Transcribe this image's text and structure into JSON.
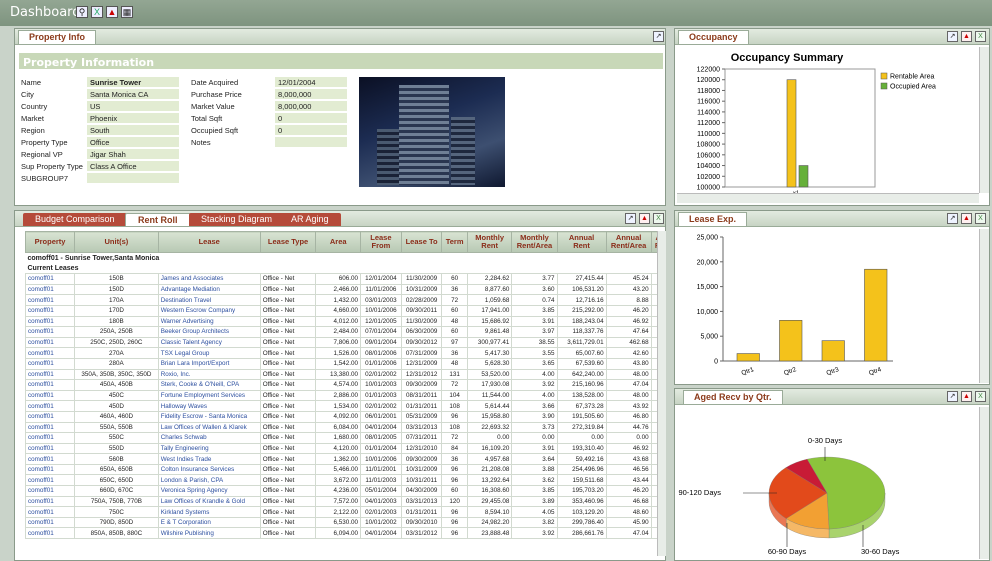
{
  "app": {
    "title": "Dashboard"
  },
  "property_info": {
    "tab": "Property Info",
    "section_title": "Property Information",
    "fields": [
      {
        "label": "Name",
        "value": "Sunrise Tower"
      },
      {
        "label": "City",
        "value": "Santa Monica CA"
      },
      {
        "label": "Country",
        "value": "US"
      },
      {
        "label": "Market",
        "value": "Phoenix"
      },
      {
        "label": "Region",
        "value": "South"
      },
      {
        "label": "Property Type",
        "value": "Office"
      },
      {
        "label": "Regional VP",
        "value": "Jigar Shah"
      },
      {
        "label": "Sup Property Type",
        "value": "Class A Office"
      },
      {
        "label": "SUBGROUP7",
        "value": ""
      }
    ],
    "fields2": [
      {
        "label": "Date Acquired",
        "value": "12/01/2004"
      },
      {
        "label": "Purchase Price",
        "value": "8,000,000"
      },
      {
        "label": "Market Value",
        "value": "8,000,000"
      },
      {
        "label": "Total Sqft",
        "value": "0"
      },
      {
        "label": "Occupied Sqft",
        "value": "0"
      },
      {
        "label": "Notes",
        "value": ""
      }
    ]
  },
  "occupancy": {
    "tab": "Occupancy",
    "chart_data": {
      "type": "bar",
      "title": "Occupancy Summary",
      "categories": [
        "x1"
      ],
      "series": [
        {
          "name": "Rentable Area",
          "values": [
            120000
          ],
          "color": "#f4c21b"
        },
        {
          "name": "Occupied Area",
          "values": [
            104000
          ],
          "color": "#66b03a"
        }
      ],
      "ylim": [
        100000,
        122000
      ],
      "yticks": [
        "122000",
        "120000",
        "118000",
        "116000",
        "114000",
        "112000",
        "110000",
        "108000",
        "106000",
        "104000",
        "102000",
        "100000"
      ],
      "legend": "top-right"
    }
  },
  "rent_roll": {
    "tabs": [
      "Budget Comparison",
      "Rent Roll",
      "Stacking Diagram",
      "AR Aging"
    ],
    "columns": [
      "Property",
      "Unit(s)",
      "Lease",
      "Lease Type",
      "Area",
      "Lease From",
      "Lease To",
      "Term",
      "Monthly Rent",
      "Monthly Rent/Area",
      "Annual Rent",
      "Annual Rent/Area",
      "Ann Rec."
    ],
    "group_title": "comoff01 - Sunrise Tower,Santa Monica",
    "subgroup_title": "Current Leases",
    "rows": [
      [
        "comoff01",
        "150B",
        "James and Associates",
        "Office - Net",
        "606.00",
        "12/01/2004",
        "11/30/2009",
        "60",
        "2,284.62",
        "3.77",
        "27,415.44",
        "45.24"
      ],
      [
        "comoff01",
        "150D",
        "Advantage Mediation",
        "Office - Net",
        "2,466.00",
        "11/01/2006",
        "10/31/2009",
        "36",
        "8,877.60",
        "3.60",
        "106,531.20",
        "43.20"
      ],
      [
        "comoff01",
        "170A",
        "Destination Travel",
        "Office - Net",
        "1,432.00",
        "03/01/2003",
        "02/28/2009",
        "72",
        "1,059.68",
        "0.74",
        "12,716.16",
        "8.88"
      ],
      [
        "comoff01",
        "170D",
        "Western Escrow Company",
        "Office - Net",
        "4,660.00",
        "10/01/2006",
        "09/30/2011",
        "60",
        "17,941.00",
        "3.85",
        "215,292.00",
        "46.20"
      ],
      [
        "comoff01",
        "180B",
        "Warner Advertising",
        "Office - Net",
        "4,012.00",
        "12/01/2005",
        "11/30/2009",
        "48",
        "15,686.92",
        "3.91",
        "188,243.04",
        "46.92"
      ],
      [
        "comoff01",
        "250A, 250B",
        "Beeker Group Architects",
        "Office - Net",
        "2,484.00",
        "07/01/2004",
        "06/30/2009",
        "60",
        "9,861.48",
        "3.97",
        "118,337.76",
        "47.64"
      ],
      [
        "comoff01",
        "250C, 250D, 260C",
        "Classic Talent Agency",
        "Office - Net",
        "7,806.00",
        "09/01/2004",
        "09/30/2012",
        "97",
        "300,977.41",
        "38.55",
        "3,611,729.01",
        "462.68"
      ],
      [
        "comoff01",
        "270A",
        "TSX Legal Group",
        "Office - Net",
        "1,526.00",
        "08/01/2006",
        "07/31/2009",
        "36",
        "5,417.30",
        "3.55",
        "65,007.60",
        "42.60"
      ],
      [
        "comoff01",
        "280A",
        "Brian Lara Import/Export",
        "Office - Net",
        "1,542.00",
        "01/01/2006",
        "12/31/2009",
        "48",
        "5,628.30",
        "3.65",
        "67,539.60",
        "43.80"
      ],
      [
        "comoff01",
        "350A, 350B, 350C, 350D",
        "Roxio, Inc.",
        "Office - Net",
        "13,380.00",
        "02/01/2002",
        "12/31/2012",
        "131",
        "53,520.00",
        "4.00",
        "642,240.00",
        "48.00"
      ],
      [
        "comoff01",
        "450A, 450B",
        "Sterk, Cooke & O'Neill, CPA",
        "Office - Net",
        "4,574.00",
        "10/01/2003",
        "09/30/2009",
        "72",
        "17,930.08",
        "3.92",
        "215,160.96",
        "47.04"
      ],
      [
        "comoff01",
        "450C",
        "Fortune Employment Services",
        "Office - Net",
        "2,886.00",
        "01/01/2003",
        "08/31/2011",
        "104",
        "11,544.00",
        "4.00",
        "138,528.00",
        "48.00"
      ],
      [
        "comoff01",
        "450D",
        "Halloway Waves",
        "Office - Net",
        "1,534.00",
        "02/01/2002",
        "01/31/2011",
        "108",
        "5,614.44",
        "3.66",
        "67,373.28",
        "43.92"
      ],
      [
        "comoff01",
        "460A, 460D",
        "Fidelity Escrow - Santa Monica",
        "Office - Net",
        "4,092.00",
        "06/01/2001",
        "05/31/2009",
        "96",
        "15,958.80",
        "3.90",
        "191,505.60",
        "46.80"
      ],
      [
        "comoff01",
        "550A, 550B",
        "Law Offices of Wallen & Klarek",
        "Office - Net",
        "6,084.00",
        "04/01/2004",
        "03/31/2013",
        "108",
        "22,693.32",
        "3.73",
        "272,319.84",
        "44.76"
      ],
      [
        "comoff01",
        "550C",
        "Charles Schwab",
        "Office - Net",
        "1,680.00",
        "08/01/2005",
        "07/31/2011",
        "72",
        "0.00",
        "0.00",
        "0.00",
        "0.00"
      ],
      [
        "comoff01",
        "550D",
        "Tally Engineering",
        "Office - Net",
        "4,120.00",
        "01/01/2004",
        "12/31/2010",
        "84",
        "16,109.20",
        "3.91",
        "193,310.40",
        "46.92"
      ],
      [
        "comoff01",
        "560B",
        "West Indies Trade",
        "Office - Net",
        "1,362.00",
        "10/01/2006",
        "09/30/2009",
        "36",
        "4,957.68",
        "3.64",
        "59,492.16",
        "43.68"
      ],
      [
        "comoff01",
        "650A, 650B",
        "Colton Insurance Services",
        "Office - Net",
        "5,466.00",
        "11/01/2001",
        "10/31/2009",
        "96",
        "21,208.08",
        "3.88",
        "254,496.96",
        "46.56"
      ],
      [
        "comoff01",
        "650C, 650D",
        "London & Parish, CPA",
        "Office - Net",
        "3,672.00",
        "11/01/2003",
        "10/31/2011",
        "96",
        "13,292.64",
        "3.62",
        "159,511.68",
        "43.44"
      ],
      [
        "comoff01",
        "660D, 670C",
        "Veronica Spring Agency",
        "Office - Net",
        "4,236.00",
        "05/01/2004",
        "04/30/2009",
        "60",
        "16,308.60",
        "3.85",
        "195,703.20",
        "46.20"
      ],
      [
        "comoff01",
        "750A, 750B, 770B",
        "Law Offices of Krandle & Gold",
        "Office - Net",
        "7,572.00",
        "04/01/2003",
        "03/31/2013",
        "120",
        "29,455.08",
        "3.89",
        "353,460.96",
        "46.68"
      ],
      [
        "comoff01",
        "750C",
        "Kirkland Systems",
        "Office - Net",
        "2,122.00",
        "02/01/2003",
        "01/31/2011",
        "96",
        "8,594.10",
        "4.05",
        "103,129.20",
        "48.60"
      ],
      [
        "comoff01",
        "790D, 850D",
        "E & T Corporation",
        "Office - Net",
        "6,530.00",
        "10/01/2002",
        "09/30/2010",
        "96",
        "24,982.20",
        "3.82",
        "299,786.40",
        "45.90"
      ],
      [
        "comoff01",
        "850A, 850B, 880C",
        "Wilshire Publishing",
        "Office - Net",
        "6,094.00",
        "04/01/2004",
        "03/31/2012",
        "96",
        "23,888.48",
        "3.92",
        "286,661.76",
        "47.04"
      ]
    ]
  },
  "lease_exp": {
    "tab": "Lease Exp.",
    "chart_data": {
      "type": "bar",
      "categories": [
        "Qtr1",
        "Qtr2",
        "Qtr3",
        "Qtr4"
      ],
      "values": [
        1500,
        8200,
        4100,
        18500
      ],
      "ylim": [
        0,
        25000
      ],
      "yticks": [
        "25,000",
        "20,000",
        "15,000",
        "10,000",
        "5,000",
        "0"
      ],
      "color": "#f4c21b"
    }
  },
  "aged_recv": {
    "tab": "Aged Recv by Qtr.",
    "chart_data": {
      "type": "pie",
      "slices": [
        {
          "label": "0-30 Days",
          "value": 55,
          "color": "#8cc43c"
        },
        {
          "label": "30-60 Days",
          "value": 13,
          "color": "#f2a033"
        },
        {
          "label": "60-90 Days",
          "value": 25,
          "color": "#e24a1b"
        },
        {
          "label": "90-120 Days",
          "value": 7,
          "color": "#c81b36"
        }
      ]
    }
  }
}
